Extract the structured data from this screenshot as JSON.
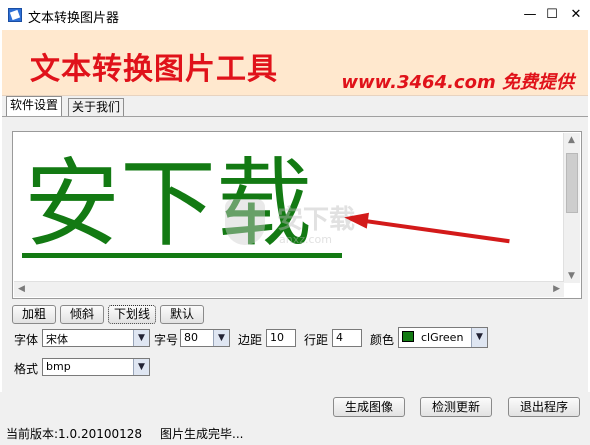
{
  "window": {
    "title": "文本转换图片器",
    "minimize": "—",
    "maximize": "☐",
    "close": "✕"
  },
  "banner": {
    "title": "文本转换图片工具",
    "site": "www.3464.com 免费提供"
  },
  "tabs": [
    "软件设置",
    "关于我们"
  ],
  "preview": {
    "text": "安下载",
    "color": "#137a13",
    "watermark": "安下载",
    "watermark_url": "anxz.com"
  },
  "style_buttons": {
    "bold": "加粗",
    "italic": "倾斜",
    "underline": "下划线",
    "default": "默认"
  },
  "fields": {
    "font_label": "字体",
    "font_value": "宋体",
    "size_label": "字号",
    "size_value": "80",
    "margin_label": "边距",
    "margin_value": "10",
    "line_spacing_label": "行距",
    "line_spacing_value": "4",
    "color_label": "颜色",
    "color_value": "clGreen",
    "format_label": "格式",
    "format_value": "bmp"
  },
  "actions": {
    "generate": "生成图像",
    "check_update": "检测更新",
    "exit": "退出程序"
  },
  "status": {
    "version": "当前版本:1.0.20100128",
    "message": "图片生成完毕..."
  }
}
